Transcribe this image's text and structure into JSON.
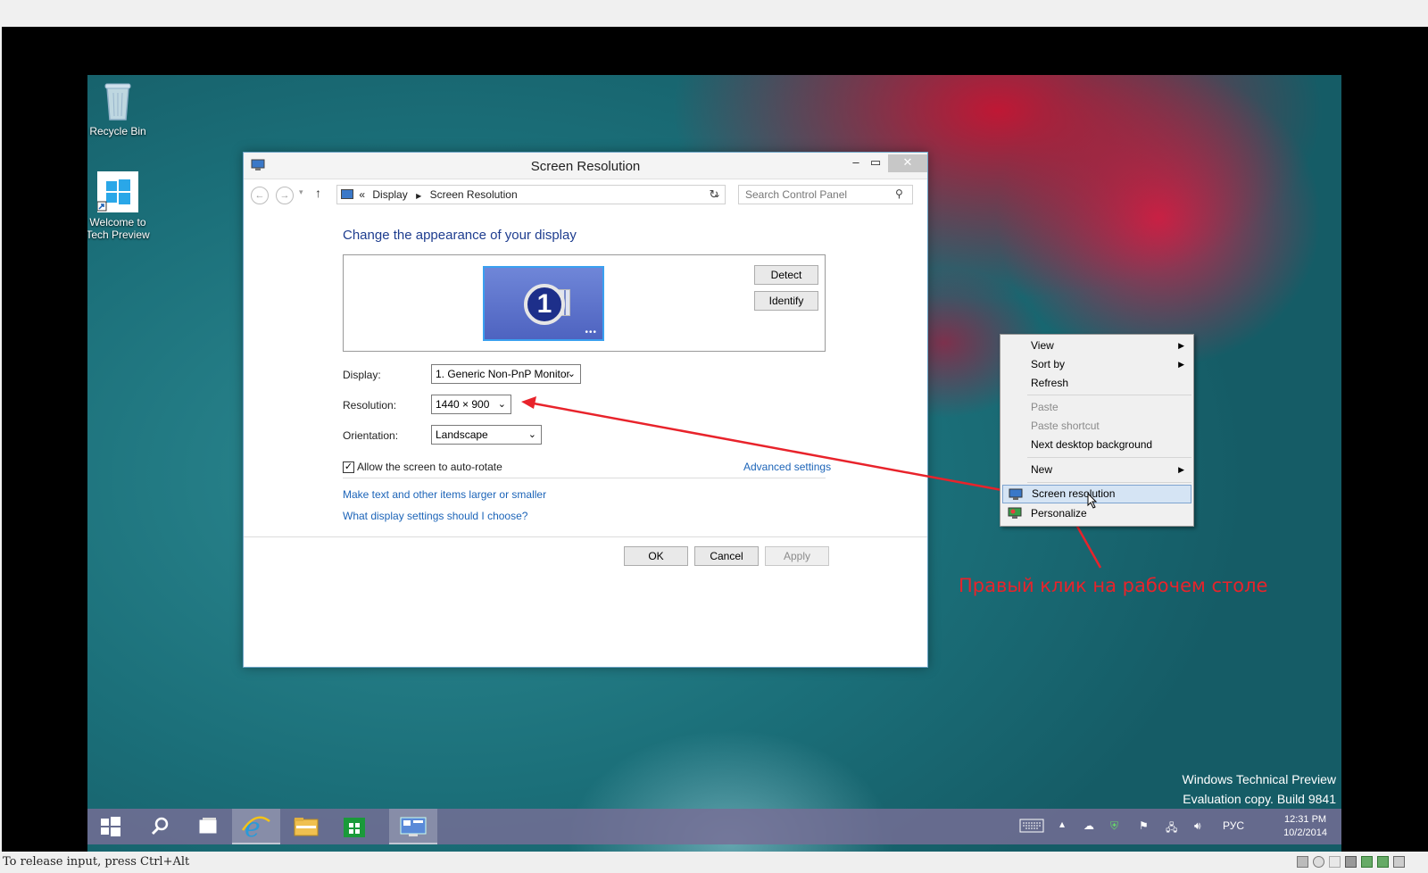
{
  "desktop": {
    "icons": [
      {
        "label_line1": "Recycle Bin",
        "label_line2": ""
      },
      {
        "label_line1": "Welcome to",
        "label_line2": "Tech Preview"
      }
    ],
    "watermark_line1": "Windows Technical Preview",
    "watermark_line2": "Evaluation copy. Build 9841"
  },
  "window": {
    "title": "Screen Resolution",
    "breadcrumb_prefix": "«",
    "breadcrumb": [
      "Display",
      "Screen Resolution"
    ],
    "search_placeholder": "Search Control Panel",
    "heading": "Change the appearance of your display",
    "monitor_number": "1",
    "detect_label": "Detect",
    "identify_label": "Identify",
    "display_label": "Display:",
    "display_value": "1. Generic Non-PnP Monitor",
    "resolution_label": "Resolution:",
    "resolution_value": "1440 × 900",
    "orientation_label": "Orientation:",
    "orientation_value": "Landscape",
    "autorotate_label": "Allow the screen to auto-rotate",
    "autorotate_checked": true,
    "advanced_link": "Advanced settings",
    "link_text_size": "Make text and other items larger or smaller",
    "link_which_settings": "What display settings should I choose?",
    "ok_label": "OK",
    "cancel_label": "Cancel",
    "apply_label": "Apply"
  },
  "context_menu": {
    "items": [
      {
        "label": "View",
        "submenu": true,
        "disabled": false
      },
      {
        "label": "Sort by",
        "submenu": true,
        "disabled": false
      },
      {
        "label": "Refresh",
        "submenu": false,
        "disabled": false
      },
      {
        "label": "Paste",
        "submenu": false,
        "disabled": true
      },
      {
        "label": "Paste shortcut",
        "submenu": false,
        "disabled": true
      },
      {
        "label": "Next desktop background",
        "submenu": false,
        "disabled": false
      },
      {
        "label": "New",
        "submenu": true,
        "disabled": false
      },
      {
        "label": "Screen resolution",
        "submenu": false,
        "disabled": false,
        "highlighted": true
      },
      {
        "label": "Personalize",
        "submenu": false,
        "disabled": false
      }
    ]
  },
  "annotation": {
    "text": "Правый клик на рабочем столе",
    "color": "#e8232b"
  },
  "taskbar": {
    "language": "РУС",
    "time": "12:31 PM",
    "date": "10/2/2014"
  },
  "host": {
    "status_text": "To release input, press Ctrl+Alt"
  },
  "colors": {
    "link": "#1c64b8",
    "heading": "#1e3d8f",
    "annotation": "#e8232b"
  }
}
